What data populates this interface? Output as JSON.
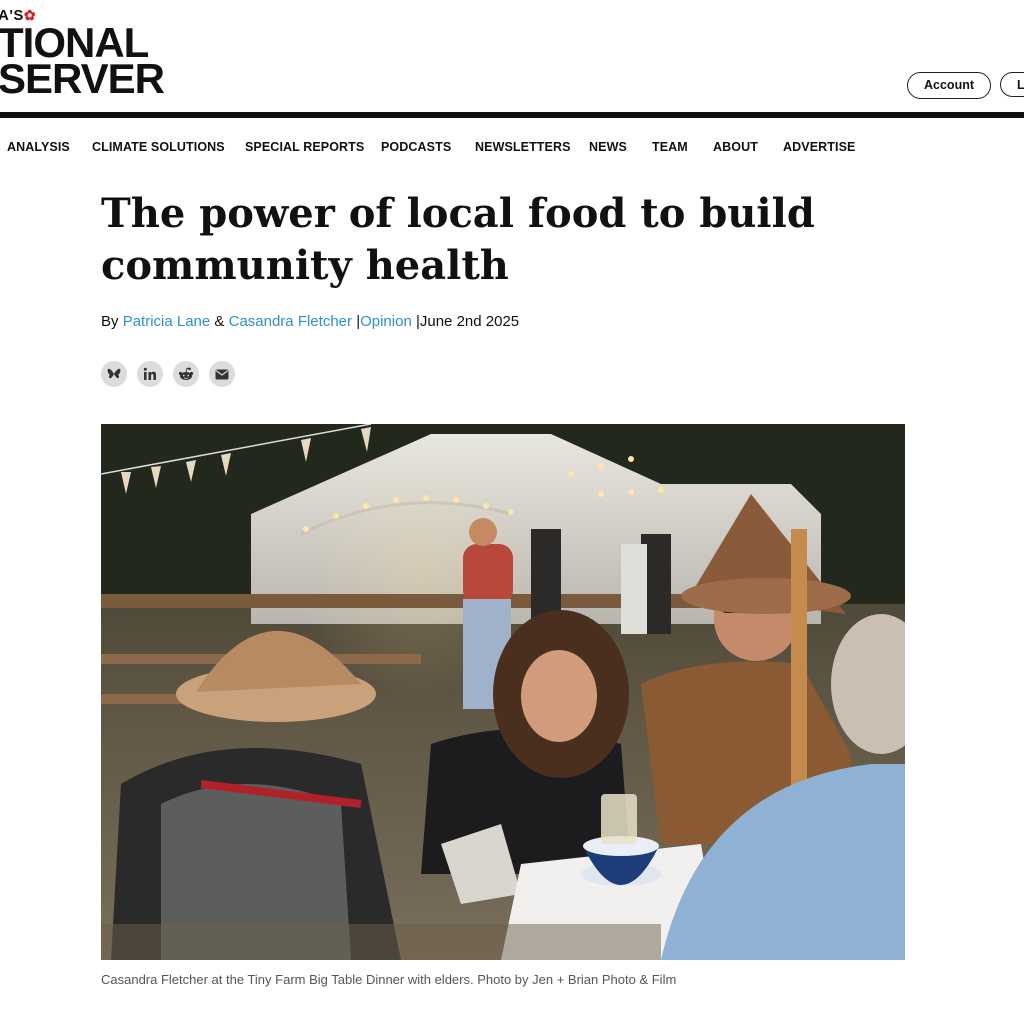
{
  "brand": {
    "line1": "A'S",
    "line2": "TIONAL",
    "line3": "SERVER",
    "leaf_color": "#d52b1e"
  },
  "header": {
    "account_label": "Account",
    "second_label": "L"
  },
  "nav": {
    "items": [
      "ANALYSIS",
      "CLIMATE SOLUTIONS",
      "SPECIAL REPORTS",
      "PODCASTS",
      "NEWSLETTERS",
      "NEWS",
      "TEAM",
      "ABOUT",
      "ADVERTISE"
    ]
  },
  "article": {
    "title": "The power of local food to build community health",
    "byline": {
      "by": "By",
      "author1": "Patricia Lane",
      "amp": "&",
      "author2": "Casandra Fletcher",
      "sep": "|",
      "section": "Opinion",
      "date": "June 2nd 2025"
    },
    "share": [
      "bluesky-icon",
      "linkedin-icon",
      "reddit-icon",
      "email-icon"
    ],
    "caption": "Casandra Fletcher at the Tiny Farm Big Table Dinner with elders. Photo by Jen + Brian Photo & Film"
  },
  "colors": {
    "link": "#2f8fd0",
    "rule": "#111111",
    "share_bg": "#dcdcdc"
  }
}
